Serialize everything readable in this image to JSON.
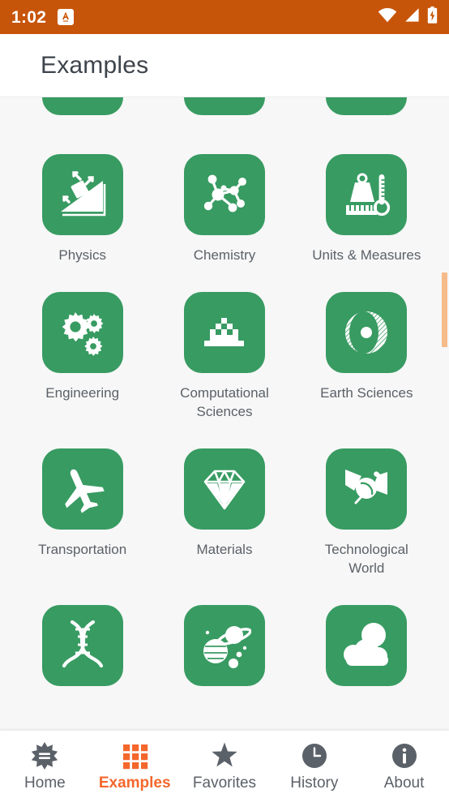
{
  "status_bar": {
    "time": "1:02",
    "app_notification_icon": "app-notification-icon",
    "wifi_icon": "wifi-icon",
    "signal_icon": "cellular-signal-icon",
    "battery_icon": "battery-charging-icon",
    "background_color": "#C75509",
    "foreground_color": "#FFFFFF"
  },
  "app_bar": {
    "title": "Examples",
    "background_color": "#FFFFFF",
    "title_color": "#3E444C"
  },
  "theme": {
    "page_background": "#F7F7F7",
    "tile_green": "#389B62",
    "accent_orange": "#F4672C",
    "status_orange": "#C75509",
    "label_gray": "#5B6168",
    "scrollbar_thumb": "#F6BB8B"
  },
  "scrollbar": {
    "name": "vertical-scrollbar",
    "thumb_color": "#F6BB8B"
  },
  "grid": {
    "rows": [
      {
        "partial": true,
        "cells": [
          {
            "label": "",
            "icon": "clipped-tile-left"
          },
          {
            "label": "",
            "icon": "clipped-tile-center"
          },
          {
            "label": "",
            "icon": "clipped-tile-right"
          }
        ]
      },
      {
        "partial": false,
        "cells": [
          {
            "label": "Physics",
            "icon": "inclined-plane-icon"
          },
          {
            "label": "Chemistry",
            "icon": "molecule-icon"
          },
          {
            "label": "Units & Measures",
            "icon": "weight-ruler-thermometer-icon"
          }
        ]
      },
      {
        "partial": false,
        "cells": [
          {
            "label": "Engineering",
            "icon": "gears-icon"
          },
          {
            "label": "Computational Sciences",
            "icon": "cellular-automaton-icon"
          },
          {
            "label": "Earth Sciences",
            "icon": "planet-cross-section-icon"
          }
        ]
      },
      {
        "partial": false,
        "cells": [
          {
            "label": "Transportation",
            "icon": "airplane-icon"
          },
          {
            "label": "Materials",
            "icon": "diamond-icon"
          },
          {
            "label": "Technological World",
            "icon": "satellite-icon"
          }
        ]
      },
      {
        "partial": true,
        "cells": [
          {
            "label": "",
            "icon": "dna-helix-icon"
          },
          {
            "label": "",
            "icon": "planets-icon"
          },
          {
            "label": "",
            "icon": "clouds-icon"
          }
        ]
      }
    ]
  },
  "bottom_nav": {
    "items": [
      {
        "label": "Home",
        "icon": "wolfram-spikey-icon",
        "active": false
      },
      {
        "label": "Examples",
        "icon": "grid-icon",
        "active": true
      },
      {
        "label": "Favorites",
        "icon": "star-icon",
        "active": false
      },
      {
        "label": "History",
        "icon": "clock-icon",
        "active": false
      },
      {
        "label": "About",
        "icon": "info-icon",
        "active": false
      }
    ]
  }
}
